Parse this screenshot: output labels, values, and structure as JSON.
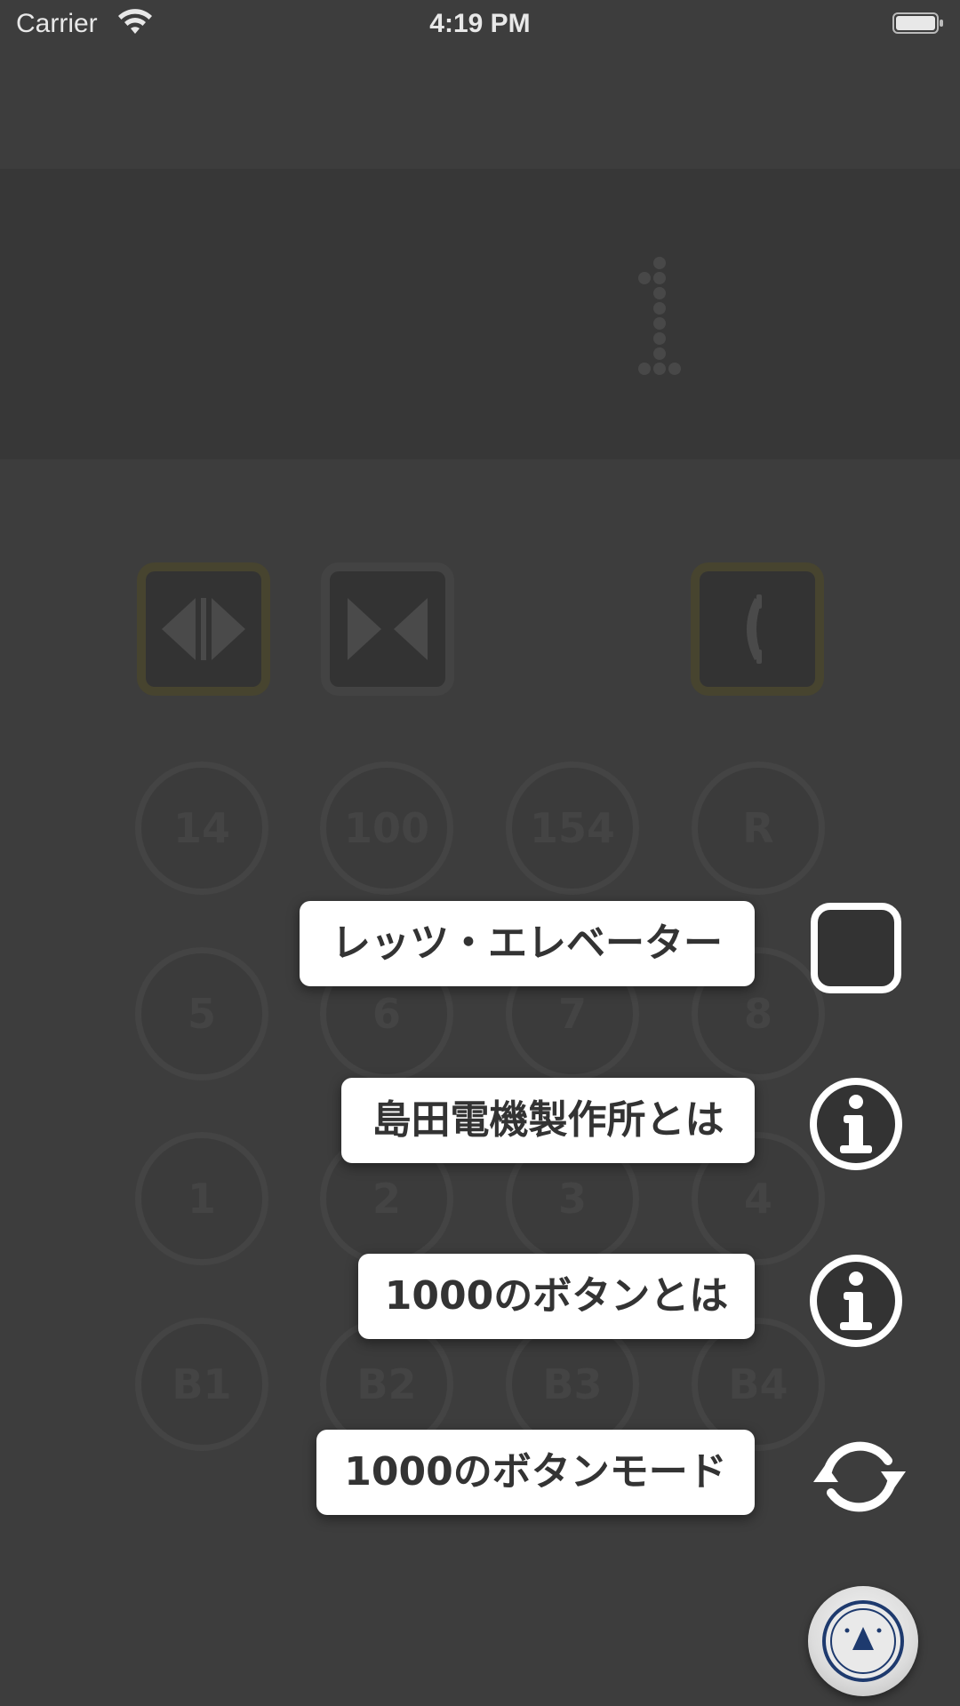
{
  "status_bar": {
    "carrier": "Carrier",
    "time": "4:19 PM"
  },
  "display": {
    "floor": "1"
  },
  "floor_buttons": [
    [
      "14",
      "100",
      "154",
      "R"
    ],
    [
      "5",
      "6",
      "7",
      "8"
    ],
    [
      "1",
      "2",
      "3",
      "4"
    ],
    [
      "B1",
      "B2",
      "B3",
      "B4"
    ]
  ],
  "menu": {
    "items": [
      {
        "label": "レッツ・エレベーター",
        "icon": "square-icon"
      },
      {
        "label": "島田電機製作所とは",
        "icon": "info-icon"
      },
      {
        "label": "1000のボタンとは",
        "icon": "info-icon"
      },
      {
        "label": "1000のボタンモード",
        "icon": "refresh-icon"
      }
    ]
  },
  "colors": {
    "background": "#3d3d3d",
    "accent": "#1e3a6e",
    "label_bg": "#ffffff"
  }
}
